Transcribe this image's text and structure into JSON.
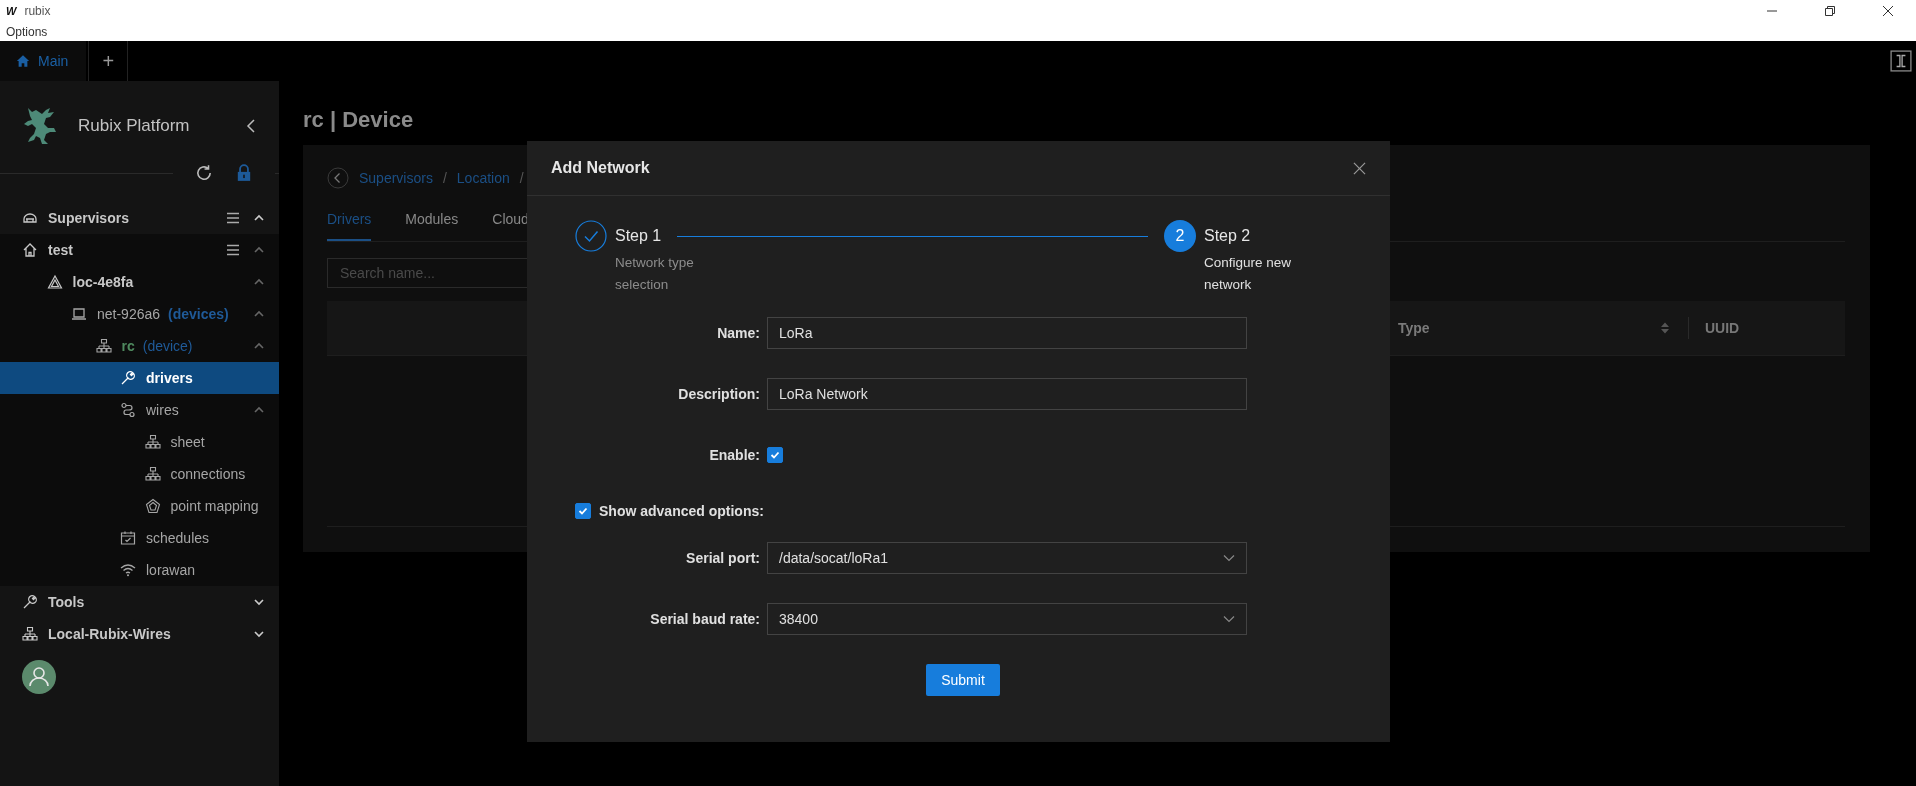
{
  "window": {
    "logo": "W",
    "title": "rubix"
  },
  "menu_bar": [
    "Options"
  ],
  "app_tabs": [
    {
      "label": "Main",
      "selected": true
    }
  ],
  "new_tab_button": "+",
  "sidebar": {
    "brand": "Rubix Platform",
    "tree": [
      {
        "label": "Supervisors",
        "kind": "supervisors",
        "menu": true,
        "expanded": true,
        "selected": false,
        "children": [
          {
            "label": "test",
            "kind": "home",
            "menu": true,
            "expanded": true,
            "selected": false,
            "children": [
              {
                "label": "loc-4e8fa",
                "kind": "location",
                "expanded": true,
                "selected": false,
                "children": [
                  {
                    "label": "net-926a6",
                    "tag": "(devices)",
                    "kind": "laptop",
                    "expanded": true,
                    "selected": false,
                    "children": [
                      {
                        "label": "rc",
                        "tag": "(device)",
                        "kind": "hierarchy",
                        "expanded": true,
                        "selected": false,
                        "children": [
                          {
                            "label": "drivers",
                            "kind": "wrench",
                            "selected": true
                          },
                          {
                            "label": "wires",
                            "kind": "wires",
                            "expanded": true,
                            "selected": false,
                            "children": [
                              {
                                "label": "sheet",
                                "kind": "hierarchy",
                                "selected": false
                              },
                              {
                                "label": "connections",
                                "kind": "hierarchy",
                                "selected": false
                              },
                              {
                                "label": "point mapping",
                                "kind": "pentagon",
                                "selected": false
                              }
                            ]
                          },
                          {
                            "label": "schedules",
                            "kind": "calendar",
                            "selected": false
                          },
                          {
                            "label": "lorawan",
                            "kind": "wifi",
                            "selected": false
                          }
                        ]
                      }
                    ]
                  }
                ]
              }
            ]
          }
        ]
      },
      {
        "label": "Tools",
        "kind": "wrench",
        "expanded": false,
        "selected": false
      },
      {
        "label": "Local-Rubix-Wires",
        "kind": "hierarchy",
        "expanded": false,
        "selected": false
      }
    ]
  },
  "page": {
    "title": "rc | Device",
    "breadcrumb": [
      {
        "label": "Supervisors",
        "kind": "link"
      },
      {
        "label": "/",
        "kind": "separator"
      },
      {
        "label": "Location",
        "kind": "link"
      },
      {
        "label": "/",
        "kind": "separator"
      }
    ],
    "tabs": [
      {
        "label": "Drivers",
        "selected": true
      },
      {
        "label": "Modules",
        "selected": false
      },
      {
        "label": "Cloud",
        "selected": false
      }
    ],
    "search": {
      "placeholder": "Search name..."
    },
    "table": {
      "columns": [
        "Type",
        "UUID"
      ]
    }
  },
  "dialog": {
    "title": "Add Network",
    "steps": [
      {
        "title": "Step 1",
        "description": "Network type selection",
        "done": true
      },
      {
        "number": "2",
        "title": "Step 2",
        "description": "Configure new network",
        "done": false
      }
    ],
    "fields": [
      {
        "kind": "text",
        "label": "Name:",
        "value": "LoRa"
      },
      {
        "kind": "text",
        "label": "Description:",
        "value": "LoRa Network"
      },
      {
        "kind": "checkbox",
        "label": "Enable:",
        "checked": true
      },
      {
        "kind": "toggle",
        "label": "Show advanced options:",
        "checked": true
      },
      {
        "kind": "select",
        "label": "Serial port:",
        "value": "/data/socat/loRa1"
      },
      {
        "kind": "select",
        "label": "Serial baud rate:",
        "value": "38400"
      }
    ],
    "submit": "Submit"
  }
}
